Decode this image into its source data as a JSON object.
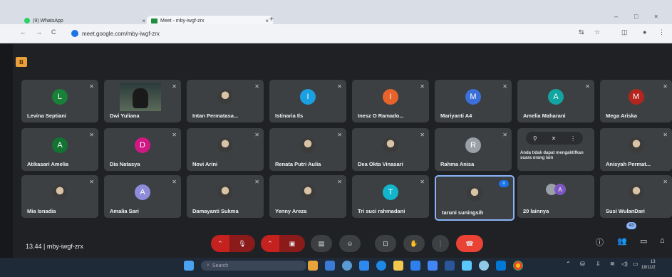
{
  "browser": {
    "tabs": [
      {
        "label": "(9) WhatsApp",
        "close": "×"
      },
      {
        "label": "Meet - mby-iwgf-zrx",
        "close": "×"
      }
    ],
    "new_tab": "+",
    "url": "meet.google.com/mby-iwgf-zrx",
    "window_controls": [
      "–",
      "□",
      "×"
    ]
  },
  "meet": {
    "logo_text": "B",
    "participants": [
      {
        "name": "Levina Septiani",
        "initial": "L",
        "color": "#188038",
        "type": "avatar"
      },
      {
        "name": "Dwi Yuliana",
        "initial": "",
        "color": "",
        "type": "video"
      },
      {
        "name": "Intan Permatasa...",
        "initial": "",
        "color": "",
        "type": "photo"
      },
      {
        "name": "Istinaria Ils",
        "initial": "I",
        "color": "#1a9fe0",
        "type": "avatar"
      },
      {
        "name": "Inesz O Ramado...",
        "initial": "I",
        "color": "#e8622c",
        "type": "avatar"
      },
      {
        "name": "Mariyanti A4",
        "initial": "M",
        "color": "#3b6fd9",
        "type": "avatar"
      },
      {
        "name": "Amelia Maharani",
        "initial": "A",
        "color": "#12a4a0",
        "type": "avatar"
      },
      {
        "name": "Mega Ariska",
        "initial": "M",
        "color": "#b3261e",
        "type": "avatar"
      },
      {
        "name": "Atikasari Amelia",
        "initial": "A",
        "color": "#137333",
        "type": "avatar"
      },
      {
        "name": "Dia Natasya",
        "initial": "D",
        "color": "#d01884",
        "type": "avatar"
      },
      {
        "name": "Novi Arini",
        "initial": "",
        "color": "",
        "type": "photo"
      },
      {
        "name": "Renata Putri Aulia",
        "initial": "",
        "color": "",
        "type": "photo"
      },
      {
        "name": "Dea Okta Vinasari",
        "initial": "",
        "color": "",
        "type": "photo"
      },
      {
        "name": "Rahma Anisa",
        "initial": "R",
        "color": "#9aa0a6",
        "type": "avatar"
      },
      {
        "name": "Anda tidak dapat mengaktifkan suara orang lain",
        "initial": "",
        "color": "",
        "type": "self"
      },
      {
        "name": "Anisyah Permat...",
        "initial": "",
        "color": "",
        "type": "photo"
      },
      {
        "name": "Mia Isnadia",
        "initial": "",
        "color": "",
        "type": "photo"
      },
      {
        "name": "Amalia Sari",
        "initial": "A",
        "color": "#8e8bd9",
        "type": "avatar"
      },
      {
        "name": "Damayanti Sukma",
        "initial": "",
        "color": "",
        "type": "photo"
      },
      {
        "name": "Yenny Areza",
        "initial": "",
        "color": "",
        "type": "photo"
      },
      {
        "name": "Tri suci rahmadani",
        "initial": "T",
        "color": "#12b5cb",
        "type": "avatar"
      },
      {
        "name": "taruni suningsih",
        "initial": "",
        "color": "",
        "type": "speaking"
      },
      {
        "name": "20 lainnya",
        "initial": "A",
        "color": "",
        "type": "others"
      },
      {
        "name": "Susi WulanDari",
        "initial": "",
        "color": "",
        "type": "photo"
      }
    ],
    "meeting_info": "13.44  |  mby-iwgf-zrx",
    "participant_count": "43"
  },
  "taskbar": {
    "search_placeholder": "Search",
    "time": "13",
    "date": "18/11/2"
  }
}
